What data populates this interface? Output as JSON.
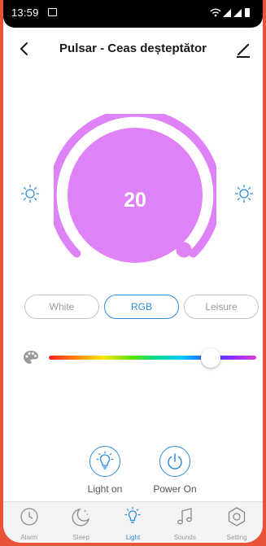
{
  "status_bar": {
    "time": "13:59"
  },
  "header": {
    "title": "Pulsar - Ceas deșteptător"
  },
  "dial": {
    "value": "20",
    "level_percent": 20
  },
  "modes": [
    {
      "label": "White",
      "active": false
    },
    {
      "label": "RGB",
      "active": true
    },
    {
      "label": "Leisure",
      "active": false
    }
  ],
  "color_slider": {
    "position_fraction": 0.78
  },
  "actions": {
    "light_on": "Light on",
    "power_on": "Power On"
  },
  "tabs": [
    {
      "label": "Alarm",
      "icon": "clock-icon"
    },
    {
      "label": "Sleep",
      "icon": "moon-icon"
    },
    {
      "label": "Light",
      "icon": "bulb-icon",
      "active": true
    },
    {
      "label": "Sounds",
      "icon": "music-note-icon"
    },
    {
      "label": "Setting",
      "icon": "gear-icon"
    }
  ],
  "colors": {
    "accent": "#2b8cd8",
    "dial": "#df82f7",
    "frame": "#e8533a"
  }
}
